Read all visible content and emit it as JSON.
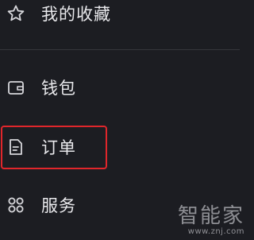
{
  "menu": {
    "items": [
      {
        "label": "我的收藏",
        "icon": "star-icon"
      },
      {
        "label": "钱包",
        "icon": "wallet-icon"
      },
      {
        "label": "订单",
        "icon": "document-icon"
      },
      {
        "label": "服务",
        "icon": "grid-icon"
      }
    ]
  },
  "watermark": {
    "logo": "智能家",
    "url": "www.znj.com"
  },
  "colors": {
    "background": "#1c1d22",
    "text": "#e9e9ec",
    "highlight": "#e0262b",
    "divider": "#35363c"
  }
}
